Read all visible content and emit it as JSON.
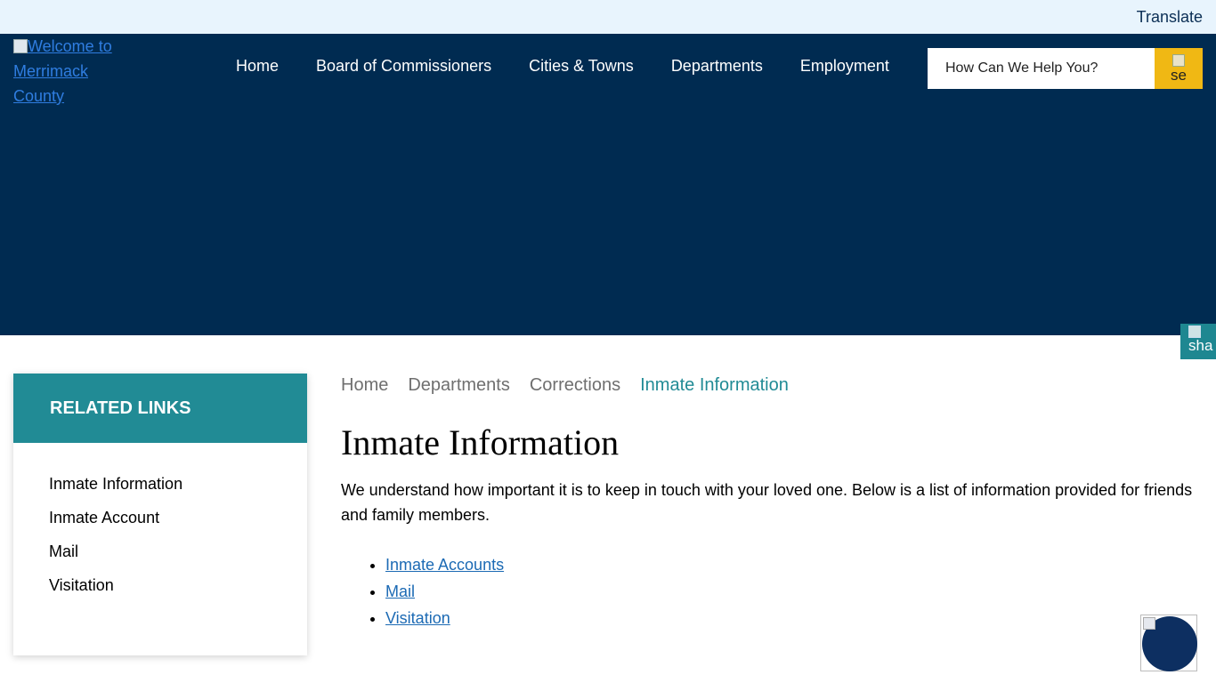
{
  "top_bar": {
    "translate_label": "Translate"
  },
  "header": {
    "logo_alt": "Welcome to Merrimack County",
    "nav": [
      {
        "label": "Home"
      },
      {
        "label": "Board of Commissioners"
      },
      {
        "label": "Cities & Towns"
      },
      {
        "label": "Departments"
      },
      {
        "label": "Employment"
      }
    ],
    "search": {
      "placeholder": "How Can We Help You?",
      "button_alt": "se"
    }
  },
  "share": {
    "alt": "sha"
  },
  "sidebar": {
    "title": "RELATED LINKS",
    "items": [
      {
        "label": "Inmate Information"
      },
      {
        "label": "Inmate Account"
      },
      {
        "label": "Mail"
      },
      {
        "label": "Visitation"
      }
    ]
  },
  "breadcrumb": [
    {
      "label": "Home"
    },
    {
      "label": "Departments"
    },
    {
      "label": "Corrections"
    },
    {
      "label": "Inmate Information"
    }
  ],
  "main": {
    "title": "Inmate Information",
    "intro": "We understand how important it is to keep in touch with your loved one.  Below is a list of information provided for friends and family members.",
    "links": [
      {
        "label": "Inmate Accounts"
      },
      {
        "label": "Mail"
      },
      {
        "label": "Visitation"
      }
    ]
  },
  "colors": {
    "header_bg": "#002b51",
    "top_bar_bg": "#e8f4fd",
    "accent_teal": "#218b95",
    "search_button": "#f0b814",
    "link": "#1c6ab4"
  }
}
